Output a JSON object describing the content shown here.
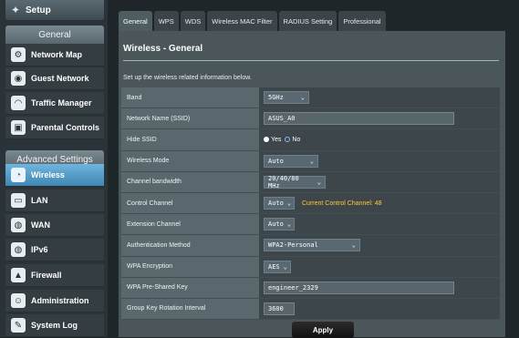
{
  "sidebar": {
    "top_item": {
      "label": "Setup",
      "icon": "magic-wand-icon"
    },
    "general_header": "General",
    "general_items": [
      {
        "label": "Network Map",
        "icon": "network-map-icon"
      },
      {
        "label": "Guest Network",
        "icon": "guest-network-icon"
      },
      {
        "label": "Traffic Manager",
        "icon": "gauge-icon"
      },
      {
        "label": "Parental Controls",
        "icon": "lock-icon"
      }
    ],
    "advanced_header": "Advanced Settings",
    "advanced_items": [
      {
        "label": "Wireless",
        "icon": "wifi-icon",
        "active": true
      },
      {
        "label": "LAN",
        "icon": "monitor-icon"
      },
      {
        "label": "WAN",
        "icon": "globe-icon"
      },
      {
        "label": "IPv6",
        "icon": "ipv6-globe-icon"
      },
      {
        "label": "Firewall",
        "icon": "firewall-icon"
      },
      {
        "label": "Administration",
        "icon": "admin-user-icon"
      },
      {
        "label": "System Log",
        "icon": "log-icon"
      }
    ]
  },
  "tabs": [
    "General",
    "WPS",
    "WDS",
    "Wireless MAC Filter",
    "RADIUS Setting",
    "Professional"
  ],
  "active_tab": "General",
  "panel": {
    "title": "Wireless - General",
    "description": "Set up the wireless related information below."
  },
  "form": {
    "band": {
      "label": "Band",
      "value": "5GHz"
    },
    "ssid": {
      "label": "Network Name (SSID)",
      "value": "ASUS_A0"
    },
    "hide_ssid": {
      "label": "Hide SSID",
      "yes": "Yes",
      "no": "No",
      "selected": "Yes"
    },
    "wireless_mode": {
      "label": "Wireless Mode",
      "value": "Auto"
    },
    "channel_bandwidth": {
      "label": "Channel bandwidth",
      "value": "20/40/80 MHz"
    },
    "control_channel": {
      "label": "Control Channel",
      "value": "Auto",
      "note": "Current Control Channel: 48"
    },
    "extension_channel": {
      "label": "Extension Channel",
      "value": "Auto"
    },
    "auth_method": {
      "label": "Authentication Method",
      "value": "WPA2-Personal"
    },
    "wpa_encryption": {
      "label": "WPA Encryption",
      "value": "AES"
    },
    "psk": {
      "label": "WPA Pre-Shared Key",
      "value": "engineer_2329"
    },
    "group_key": {
      "label": "Group Key Rotation Interval",
      "value": "3600"
    }
  },
  "apply_label": "Apply",
  "colors": {
    "accent": "#3f86b4",
    "note": "#ffcc33",
    "panel": "#4b565b"
  }
}
